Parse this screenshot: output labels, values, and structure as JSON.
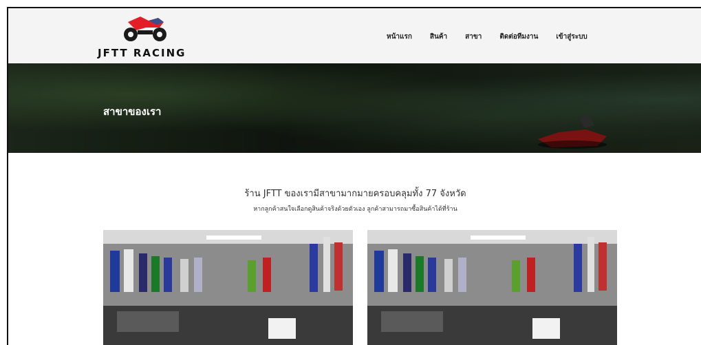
{
  "brand": {
    "name": "JFTT RACING",
    "logo_icon": "motorcycle-icon",
    "colors": {
      "primary": "#e41e26",
      "dark": "#1a1a1a"
    }
  },
  "nav": {
    "items": [
      {
        "label": "หน้าแรก"
      },
      {
        "label": "สินค้า"
      },
      {
        "label": "สาขา"
      },
      {
        "label": "ติดต่อทีมงาน"
      },
      {
        "label": "เข้าสู่ระบบ"
      }
    ]
  },
  "hero": {
    "title": "สาขาของเรา"
  },
  "intro": {
    "title": "ร้าน JFTT ของเรามีสาขามากมายครอบคลุมทั้ง 77 จังหวัด",
    "subtitle": "หากลูกค้าสนใจเลือกดูสินค้าจริงด้วยตัวเอง ลูกค้าสามารถมาซื้อสินค้าได้ที่ร้าน"
  },
  "gallery": {
    "photos": [
      {
        "subject": "store-interior"
      },
      {
        "subject": "store-interior"
      }
    ]
  }
}
